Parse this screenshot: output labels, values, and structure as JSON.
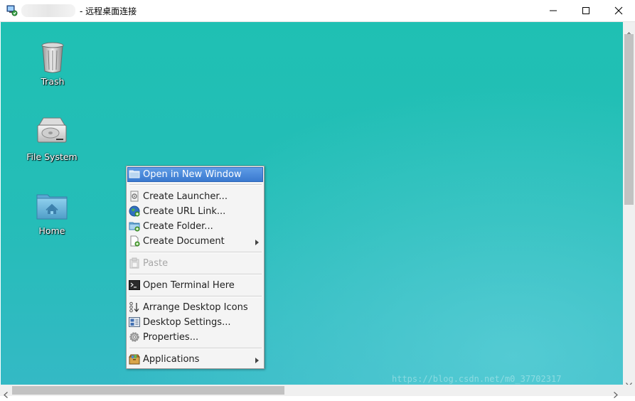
{
  "window": {
    "title": "- 远程桌面连接",
    "icon": "remote-desktop-icon"
  },
  "desktop_icons": [
    {
      "label": "Trash",
      "icon": "trash-icon"
    },
    {
      "label": "File System",
      "icon": "hard-drive-icon"
    },
    {
      "label": "Home",
      "icon": "home-folder-icon"
    }
  ],
  "context_menu": {
    "items": [
      {
        "label": "Open in New Window",
        "icon": "folder-icon",
        "state": "highlighted"
      },
      {
        "label": "Create Launcher...",
        "icon": "launcher-icon"
      },
      {
        "label": "Create URL Link...",
        "icon": "globe-icon"
      },
      {
        "label": "Create Folder...",
        "icon": "new-folder-icon"
      },
      {
        "label": "Create Document",
        "icon": "new-document-icon",
        "submenu": true
      },
      {
        "label": "Paste",
        "icon": "paste-icon",
        "state": "disabled"
      },
      {
        "label": "Open Terminal Here",
        "icon": "terminal-icon"
      },
      {
        "label": "Arrange Desktop Icons",
        "icon": "arrange-icon"
      },
      {
        "label": "Desktop Settings...",
        "icon": "desktop-settings-icon"
      },
      {
        "label": "Properties...",
        "icon": "gear-icon"
      },
      {
        "label": "Applications",
        "icon": "applications-icon",
        "submenu": true
      }
    ]
  },
  "watermark": "https://blog.csdn.net/m0_37702317",
  "colors": {
    "desktop_top": "#1fc0b3",
    "desktop_bottom": "#34b9c5",
    "menu_highlight": "#3a79cf",
    "menu_background": "#f4f4f4"
  }
}
